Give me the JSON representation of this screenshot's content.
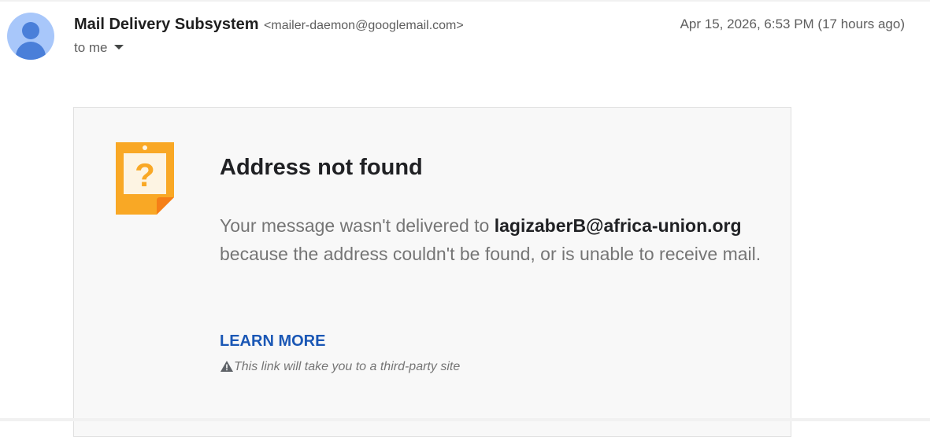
{
  "header": {
    "sender_name": "Mail Delivery Subsystem",
    "sender_email": "<mailer-daemon@googlemail.com>",
    "timestamp": "Apr 15, 2026, 6:53 PM (17 hours ago)",
    "recipient_label": "to me",
    "avatar_icon": "person-icon"
  },
  "notice": {
    "icon": "question-document-icon",
    "title": "Address not found",
    "body_prefix": "Your message wasn't delivered to ",
    "address": "lagizaberB@africa-union.org",
    "body_suffix": " because the address couldn't be found, or is unable to receive mail.",
    "link_label": "LEARN MORE",
    "warning_icon": "warning-triangle-icon",
    "warning_text": "This link will take you to a third-party site"
  },
  "colors": {
    "avatar_background": "#a8c7fa",
    "avatar_figure": "#4a7fd9",
    "icon_orange": "#f9a825",
    "link_blue": "#1a57b5",
    "card_background": "#f8f8f8"
  }
}
